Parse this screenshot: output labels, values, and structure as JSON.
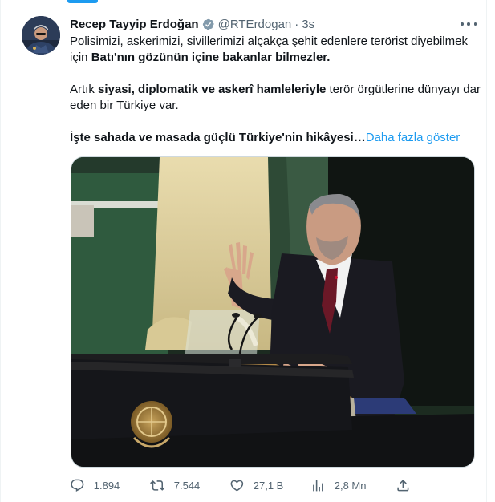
{
  "tweet": {
    "author_name": "Recep Tayyip Erdoğan",
    "handle": "@RTErdogan",
    "separator": "·",
    "time": "3s",
    "line1": "Polisimizi, askerimizi, sivillerimizi alçakça şehit edenlere terörist diyebilmek için",
    "line1_bold": "Batı'nın gözünün içine bakanlar bilmezler.",
    "p2_start": "Artık",
    "p2_bold": "siyasi, diplomatik ve askerî hamleleriyle",
    "p2_end": "terör örgütlerine dünyayı dar eden bir Türkiye var.",
    "p3_bold": "İşte sahada ve masada güçlü Türkiye'nin hikâyesi…",
    "show_more": "Daha fazla göster"
  },
  "actions": {
    "replies": "1.894",
    "reposts": "7.544",
    "likes": "27,1 B",
    "views": "2,8 Mn"
  },
  "icons": [
    "verified-badge-icon",
    "more-icon",
    "reply-icon",
    "repost-icon",
    "like-icon",
    "views-icon",
    "share-icon"
  ],
  "colors": {
    "accent": "#1d9bf0",
    "text": "#0f1419",
    "muted": "#536471"
  }
}
